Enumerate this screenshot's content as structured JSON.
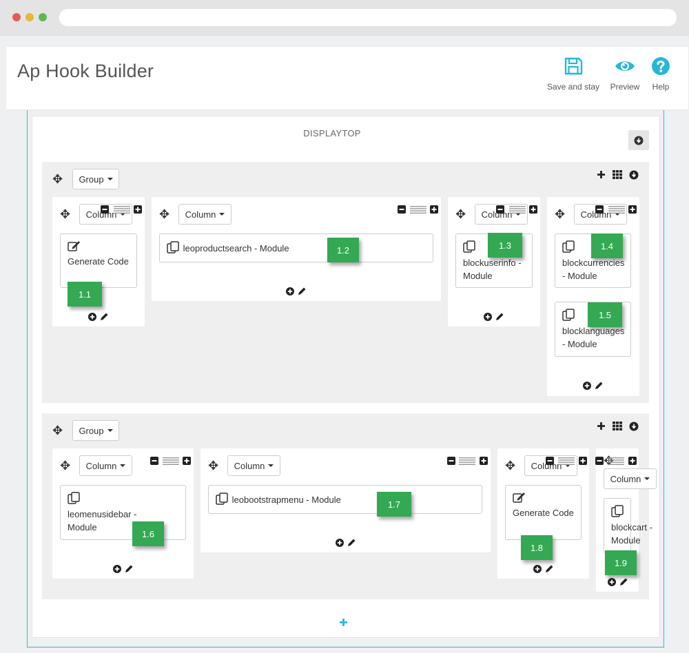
{
  "app": {
    "title": "Ap Hook Builder",
    "accent": "#25b9d7",
    "badge_color": "#34a853"
  },
  "toolbar": {
    "save_label": "Save and stay",
    "preview_label": "Preview",
    "help_label": "Help",
    "save_icon": "floppy-disk-icon",
    "preview_icon": "eye-icon",
    "help_icon": "question-circle-icon"
  },
  "hook": {
    "name": "DISPLAYTOP",
    "add_label": "+"
  },
  "labels": {
    "group": "Group",
    "column": "Column"
  },
  "groups": [
    {
      "columns": [
        {
          "modules": [
            {
              "name": "Generate Code",
              "type": "code",
              "badge": "1.1"
            }
          ]
        },
        {
          "modules": [
            {
              "name": "leoproductsearch  - Module",
              "type": "module",
              "badge": "1.2"
            }
          ]
        },
        {
          "modules": [
            {
              "name": "blockuserinfo - Module",
              "type": "module",
              "badge": "1.3"
            }
          ]
        },
        {
          "modules": [
            {
              "name": "blockcurrencies - Module",
              "type": "module",
              "badge": "1.4"
            },
            {
              "name": "blocklanguages - Module",
              "type": "module",
              "badge": "1.5"
            }
          ]
        }
      ]
    },
    {
      "columns": [
        {
          "modules": [
            {
              "name": "leomenusidebar - Module",
              "type": "module",
              "badge": "1.6"
            }
          ]
        },
        {
          "modules": [
            {
              "name": "leobootstrapmenu  - Module",
              "type": "module",
              "badge": "1.7"
            }
          ]
        },
        {
          "modules": [
            {
              "name": "Generate Code",
              "type": "code",
              "badge": "1.8"
            }
          ]
        },
        {
          "modules": [
            {
              "name": "blockcart - Module",
              "type": "module",
              "badge": "1.9"
            }
          ]
        }
      ]
    }
  ]
}
